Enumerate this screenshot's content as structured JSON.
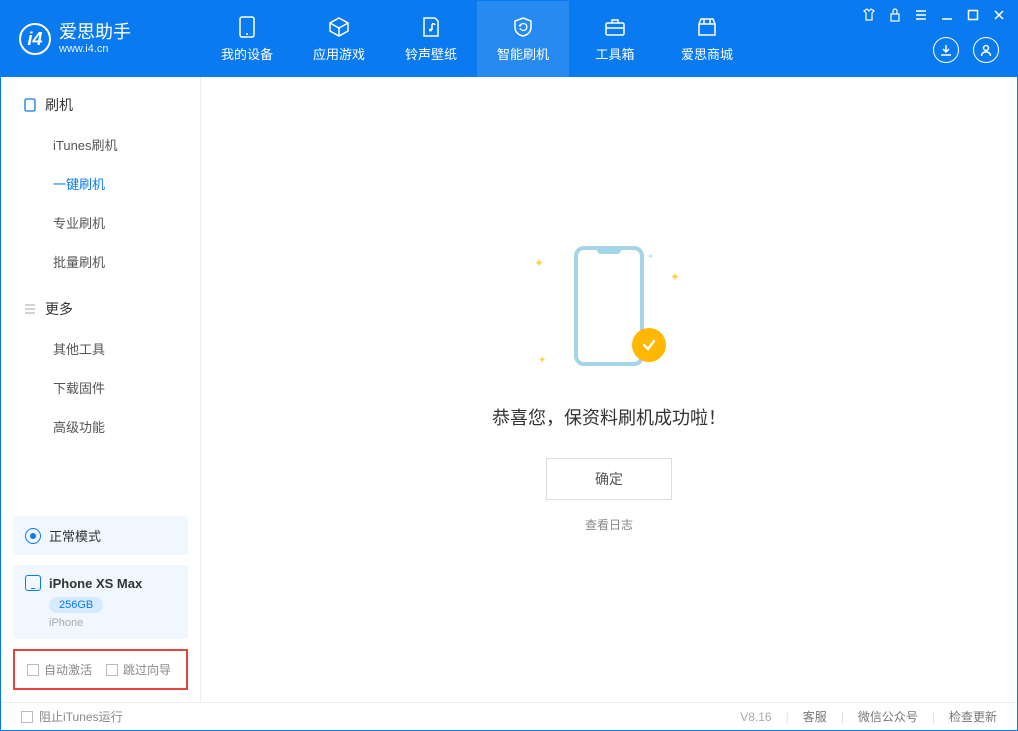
{
  "header": {
    "logo_title": "爱思助手",
    "logo_sub": "www.i4.cn",
    "tabs": [
      {
        "label": "我的设备"
      },
      {
        "label": "应用游戏"
      },
      {
        "label": "铃声壁纸"
      },
      {
        "label": "智能刷机"
      },
      {
        "label": "工具箱"
      },
      {
        "label": "爱思商城"
      }
    ]
  },
  "sidebar": {
    "section1_title": "刷机",
    "section1_items": [
      {
        "label": "iTunes刷机"
      },
      {
        "label": "一键刷机"
      },
      {
        "label": "专业刷机"
      },
      {
        "label": "批量刷机"
      }
    ],
    "section2_title": "更多",
    "section2_items": [
      {
        "label": "其他工具"
      },
      {
        "label": "下载固件"
      },
      {
        "label": "高级功能"
      }
    ],
    "mode_label": "正常模式",
    "device_name": "iPhone XS Max",
    "device_storage": "256GB",
    "device_type": "iPhone",
    "checkbox1": "自动激活",
    "checkbox2": "跳过向导"
  },
  "main": {
    "success_msg": "恭喜您，保资料刷机成功啦！",
    "confirm_label": "确定",
    "log_link": "查看日志"
  },
  "footer": {
    "prevent_itunes": "阻止iTunes运行",
    "version": "V8.16",
    "links": [
      "客服",
      "微信公众号",
      "检查更新"
    ]
  }
}
